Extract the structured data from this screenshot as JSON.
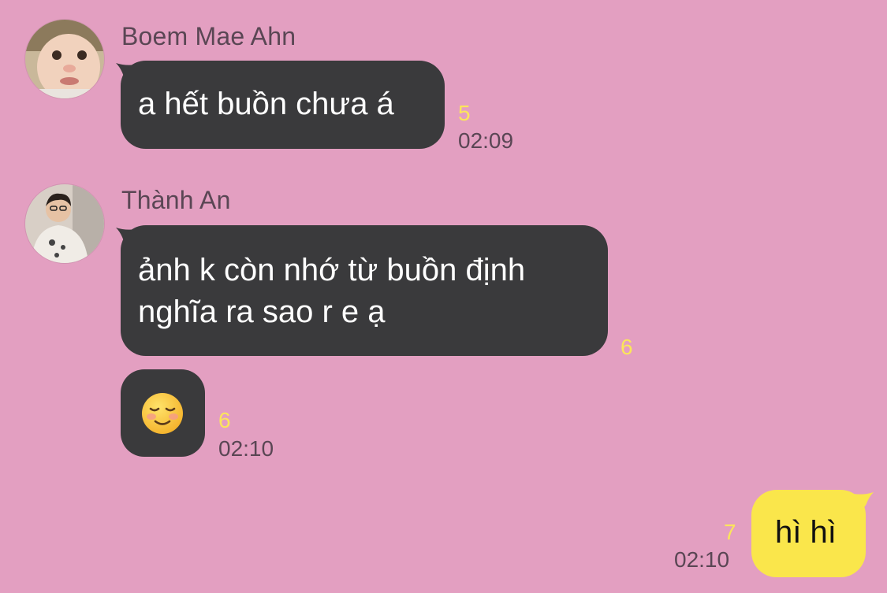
{
  "messages": [
    {
      "sender": "Boem Mae Ahn",
      "text": "a hết buồn chưa á",
      "unread": "5",
      "time": "02:09"
    },
    {
      "sender": "Thành An",
      "line1": "ảnh k còn nhớ từ buồn định",
      "line2": "nghĩa ra sao r e ạ",
      "unread": "6"
    },
    {
      "emoji": "☺️",
      "unread": "6",
      "time": "02:10"
    },
    {
      "text": "hì hì",
      "unread": "7",
      "time": "02:10"
    }
  ],
  "colors": {
    "background": "#e39fc1",
    "incoming_bubble": "#3a3a3c",
    "outgoing_bubble": "#fae64b",
    "unread_count": "#fbe65a",
    "meta_text": "#5a4654"
  }
}
